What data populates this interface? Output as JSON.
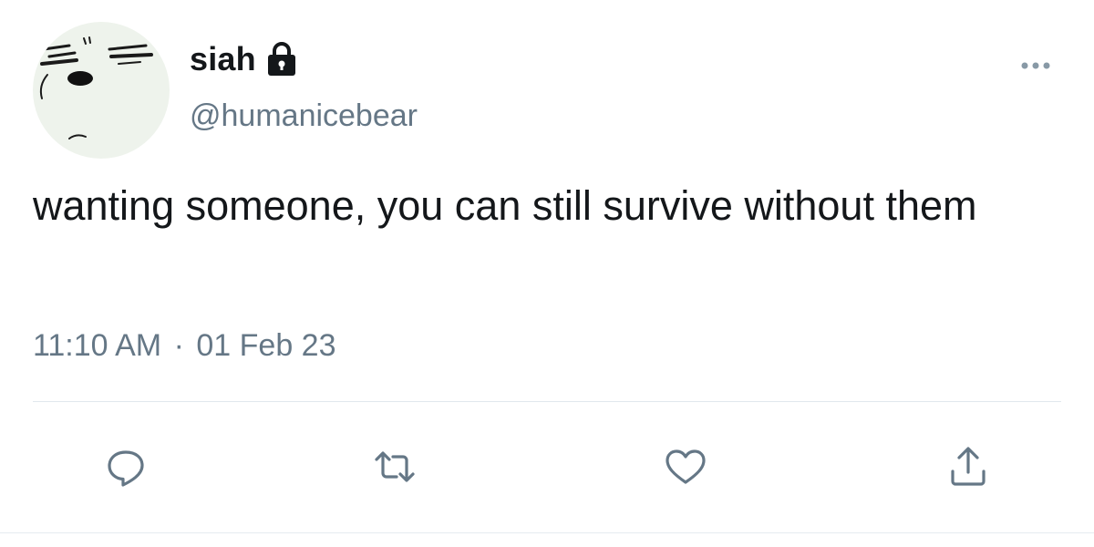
{
  "user": {
    "display_name": "siah",
    "handle": "@humanicebear",
    "protected_icon": "lock-icon",
    "avatar_icon": "cartoon-face-avatar"
  },
  "tweet": {
    "text": "wanting someone, you can still survive without them",
    "time": "11:10 AM",
    "separator": "·",
    "date": "01 Feb 23"
  },
  "actions": {
    "reply_icon": "speech-bubble-icon",
    "retweet_icon": "retweet-icon",
    "like_icon": "heart-icon",
    "share_icon": "share-icon",
    "more_icon": "ellipsis-icon"
  },
  "colors": {
    "primary_text": "#14171a",
    "secondary_text": "#657786",
    "icon": "#657786",
    "divider": "#e1e8ed",
    "avatar_bg": "#eef3ec"
  }
}
